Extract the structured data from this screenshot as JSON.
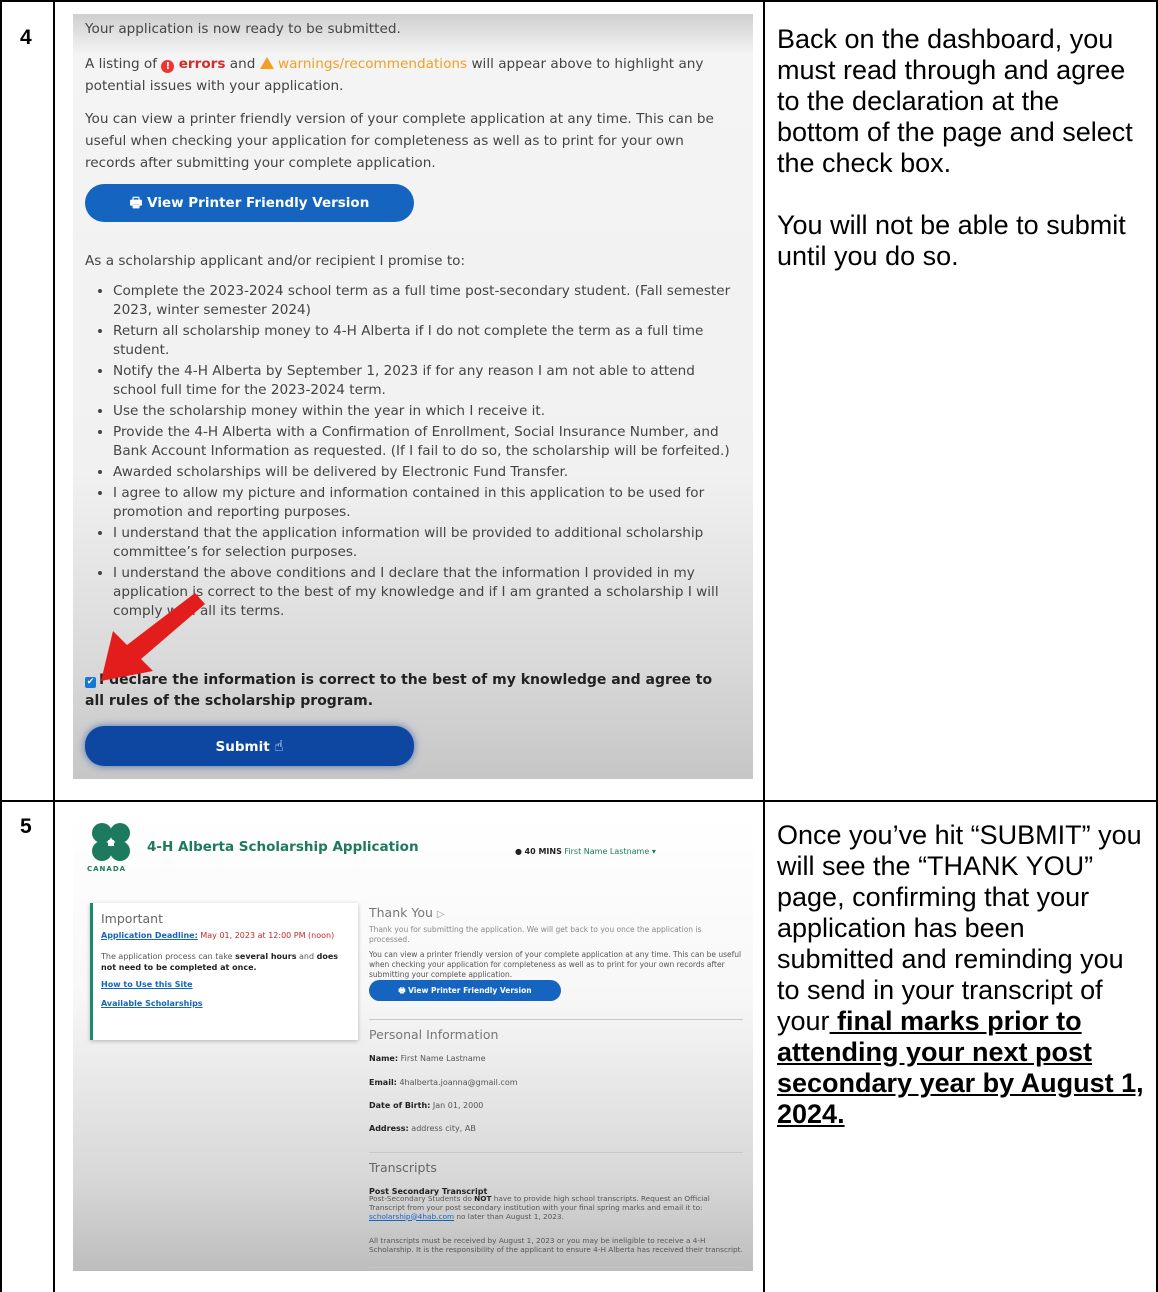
{
  "rows": [
    {
      "number": "4",
      "description": [
        "Back on the dashboard, you must read through and agree to the declaration at the bottom of the page and select the check box.",
        "You will not be able to submit until you do so."
      ],
      "screenshot": {
        "intro": "Your application is now ready to be submitted.",
        "listing_prefix": "A listing of",
        "errors_label": "errors",
        "and_word": "and",
        "warnings_label": "warnings/recommendations",
        "listing_suffix": "will appear above to highlight any potential issues with your application.",
        "printer_text": "You can view a printer friendly version of your complete application at any time. This can be useful when checking your application for completeness as well as to print for your own records after submitting your complete application.",
        "printer_button": "View Printer Friendly Version",
        "promise_intro": "As a scholarship applicant and/or recipient I promise to:",
        "promises": [
          "Complete the 2023-2024 school term as a full time post-secondary student. (Fall semester 2023, winter semester 2024)",
          "Return all scholarship money to 4-H Alberta if I do not complete the term as a full time student.",
          "Notify the 4-H Alberta by September 1, 2023 if for any reason I am not able to attend school full time for the 2023-2024 term.",
          "Use the scholarship money within the year in which I receive it.",
          "Provide the 4-H Alberta with a Confirmation of Enrollment, Social Insurance Number, and Bank Account Information as requested. (If I fail to do so, the scholarship will be forfeited.)",
          "Awarded scholarships will be delivered by Electronic Fund Transfer.",
          "I agree to allow my picture and information contained in this application to be used for promotion and reporting purposes.",
          "I understand that the application information will be provided to additional scholarship committee’s for selection purposes.",
          "I understand the above conditions and I declare that the information I provided in my application is correct to the best of my knowledge and if I am granted a scholarship I will comply with all its terms."
        ],
        "declaration": "I declare the information is correct to the best of my knowledge and agree to all rules of the scholarship program.",
        "submit_button": "Submit"
      }
    },
    {
      "number": "5",
      "description_prefix": "Once you’ve hit “SUBMIT” you will see the “THANK YOU” page, confirming that your application has been submitted and reminding you to send in your transcript of your",
      "description_emphasis": " final marks prior to attending your next post secondary year by August 1, 2024.",
      "screenshot": {
        "app_title": "4-H Alberta Scholarship Application",
        "logo_caption": "CANADA",
        "timer": "40 MINS",
        "user_name": "First Name Lastname",
        "important_heading": "Important",
        "deadline_label": "Application Deadline:",
        "deadline_value": "May 01, 2023 at 12:00 PM (noon)",
        "process_prefix": "The application process can take",
        "process_bold1": "several hours",
        "process_mid": "and",
        "process_bold2": "does not need to be completed at once.",
        "link_how": "How to Use this Site",
        "link_available": "Available Scholarships",
        "thank_heading": "Thank You",
        "thank_text": "Thank you for submitting the application. We will get back to you once the application is processed.",
        "printer_text": "You can view a printer friendly version of your complete application at any time. This can be useful when checking your application for completeness as well as to print for your own records after submitting your complete application.",
        "printer_button": "View Printer Friendly Version",
        "personal_heading": "Personal Information",
        "name_label": "Name:",
        "name_value": "First Name Lastname",
        "email_label": "Email:",
        "email_value": "4halberta.joanna@gmail.com",
        "dob_label": "Date of Birth:",
        "dob_value": "Jan 01, 2000",
        "address_label": "Address:",
        "address_value": "address city, AB",
        "transcripts_heading": "Transcripts",
        "pst_heading": "Post Secondary Transcript",
        "pst_text_1": "Post-Secondary Students do",
        "pst_not": "NOT",
        "pst_text_2": "have to provide high school transcripts. Request an Official Transcript from your post secondary institution with your final spring marks and email it to:",
        "pst_email": "scholarship@4hab.com",
        "pst_text_3": "no later than August 1, 2023.",
        "pst_text_4": "All transcripts must be received by August 1, 2023 or you may be ineligible to receive a 4-H Scholarship. It is the responsibility of the applicant to ensure 4-H Alberta has received their transcript."
      }
    }
  ],
  "colors": {
    "primary_button": "#1565c0",
    "error": "#d22d2d",
    "warning": "#f0a023",
    "brand_green": "#1d7a5f",
    "arrow": "#e31c1c"
  }
}
